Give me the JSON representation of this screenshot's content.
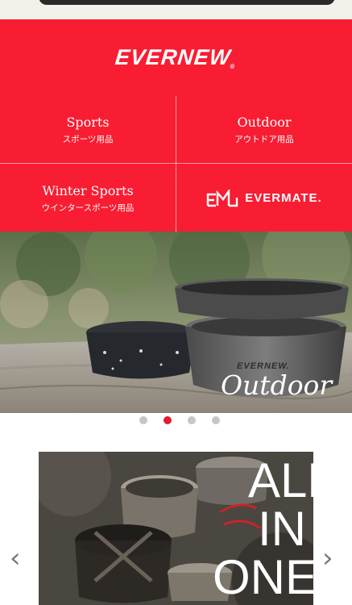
{
  "brand": {
    "logo_text": "EVERNEW",
    "logo_mark": "®"
  },
  "categories": [
    {
      "en": "Sports",
      "jp": "スポーツ用品"
    },
    {
      "en": "Outdoor",
      "jp": "アウトドア用品"
    },
    {
      "en": "Winter Sports",
      "jp": "ウインタースポーツ用品"
    }
  ],
  "evermate": {
    "logo_text": "EVERMATE."
  },
  "hero": {
    "caption": "Outdoor",
    "product_brand": "EVERNEW."
  },
  "carousel": {
    "slide_count": 4,
    "active_index": 1
  },
  "promo": {
    "lines": [
      "ALL",
      "IN",
      "ONE"
    ]
  },
  "nav": {
    "prev": "‹",
    "next": "›"
  },
  "colors": {
    "brand_red": "#f81d32",
    "dot_active": "#e41b2e",
    "dot_inactive": "#c6c6c6"
  }
}
